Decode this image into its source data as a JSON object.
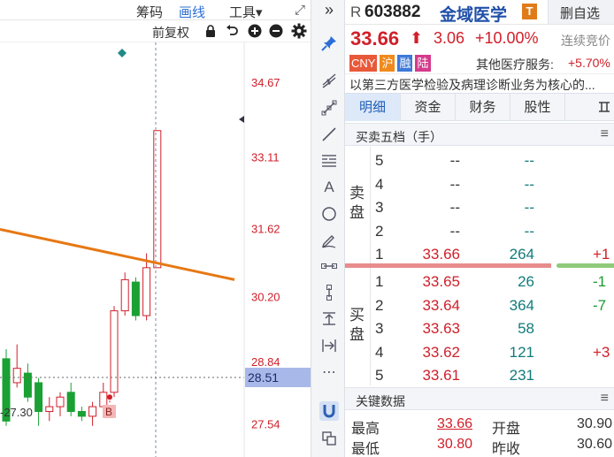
{
  "chart_toolbar": {
    "tab_chips": "筹码",
    "tab_draw": "画线",
    "tab_tools": "工具▾",
    "expand_glyph": "⤢",
    "collapse_glyph": "»"
  },
  "chart_subbar": {
    "adjust_label": "前复权"
  },
  "chart": {
    "price_labels": [
      "34.67",
      "33.11",
      "31.62",
      "30.20",
      "28.84",
      "27.54"
    ],
    "current_price_tag": "28.51",
    "low_marker": "-27.30",
    "b_marker": "B",
    "colors": {
      "up": "#d0202a",
      "down": "#1aa033",
      "trend": "#e67814",
      "tag_bg": "#a8b8e8"
    }
  },
  "chart_data": {
    "type": "candlestick",
    "title": "",
    "y_ticks": [
      34.67,
      33.11,
      31.62,
      30.2,
      28.84,
      27.54
    ],
    "ylim": [
      26.85,
      35.5
    ],
    "reference_line": 28.51,
    "candles": [
      {
        "open": 28.9,
        "close": 27.6,
        "high": 29.1,
        "low": 27.5
      },
      {
        "open": 28.4,
        "close": 28.7,
        "high": 29.2,
        "low": 28.3
      },
      {
        "open": 28.6,
        "close": 28.1,
        "high": 28.8,
        "low": 28.0
      },
      {
        "open": 28.4,
        "close": 27.8,
        "high": 28.5,
        "low": 27.5
      },
      {
        "open": 27.8,
        "close": 27.9,
        "high": 28.1,
        "low": 27.6
      },
      {
        "open": 27.9,
        "close": 28.1,
        "high": 28.2,
        "low": 27.7
      },
      {
        "open": 28.2,
        "close": 27.8,
        "high": 28.4,
        "low": 27.7
      },
      {
        "open": 27.8,
        "close": 27.7,
        "high": 27.9,
        "low": 27.6
      },
      {
        "open": 27.7,
        "close": 27.9,
        "high": 28.0,
        "low": 27.5
      },
      {
        "open": 27.9,
        "close": 28.2,
        "high": 28.4,
        "low": 27.8
      },
      {
        "open": 28.2,
        "close": 29.9,
        "high": 30.0,
        "low": 28.1
      },
      {
        "open": 29.9,
        "close": 30.55,
        "high": 30.7,
        "low": 29.8
      },
      {
        "open": 30.5,
        "close": 29.8,
        "high": 30.6,
        "low": 29.7
      },
      {
        "open": 29.8,
        "close": 30.8,
        "high": 31.1,
        "low": 29.7
      },
      {
        "open": 30.8,
        "close": 33.66,
        "high": 33.66,
        "low": 30.8
      }
    ],
    "trendline": {
      "from": 31.6,
      "to": 30.55
    }
  },
  "quote": {
    "r_badge": "R",
    "code": "603882",
    "name": "金域医学",
    "t_badge": "T",
    "delete_fav": "删自选",
    "price": "33.66",
    "arrow": "⬆",
    "change": "3.06",
    "pct": "+10.00%",
    "auction": "连续竞价",
    "tags": [
      {
        "text": "CNY",
        "color": "#e8593a"
      },
      {
        "text": "沪",
        "color": "#f08a1c"
      },
      {
        "text": "融",
        "color": "#3d79d8"
      },
      {
        "text": "陆",
        "color": "#d43a8c"
      }
    ],
    "sector_label": "其他医疗服务:",
    "sector_pct": "+5.70%",
    "description": "以第三方医学检验及病理诊断业务为核心的..."
  },
  "tabs": [
    "明细",
    "资金",
    "财务",
    "股性",
    "𝌆"
  ],
  "orderbook": {
    "title": "买卖五档（手）",
    "sell_label": "卖盘",
    "buy_label": "买盘",
    "sell": [
      {
        "idx": "5",
        "price": "--",
        "vol": "--",
        "chg": ""
      },
      {
        "idx": "4",
        "price": "--",
        "vol": "--",
        "chg": ""
      },
      {
        "idx": "3",
        "price": "--",
        "vol": "--",
        "chg": ""
      },
      {
        "idx": "2",
        "price": "--",
        "vol": "--",
        "chg": ""
      },
      {
        "idx": "1",
        "price": "33.66",
        "vol": "264",
        "chg": "+1"
      }
    ],
    "buy": [
      {
        "idx": "1",
        "price": "33.65",
        "vol": "26",
        "chg": "-1"
      },
      {
        "idx": "2",
        "price": "33.64",
        "vol": "364",
        "chg": "-7"
      },
      {
        "idx": "3",
        "price": "33.63",
        "vol": "58",
        "chg": ""
      },
      {
        "idx": "4",
        "price": "33.62",
        "vol": "121",
        "chg": "+3"
      },
      {
        "idx": "5",
        "price": "33.61",
        "vol": "231",
        "chg": ""
      }
    ]
  },
  "key_data": {
    "title": "关键数据",
    "high_label": "最高",
    "high_value": "33.66",
    "open_label": "开盘",
    "open_value": "30.90",
    "low_label": "最低",
    "low_value": "30.80",
    "prev_label": "昨收",
    "prev_value": "30.60"
  }
}
